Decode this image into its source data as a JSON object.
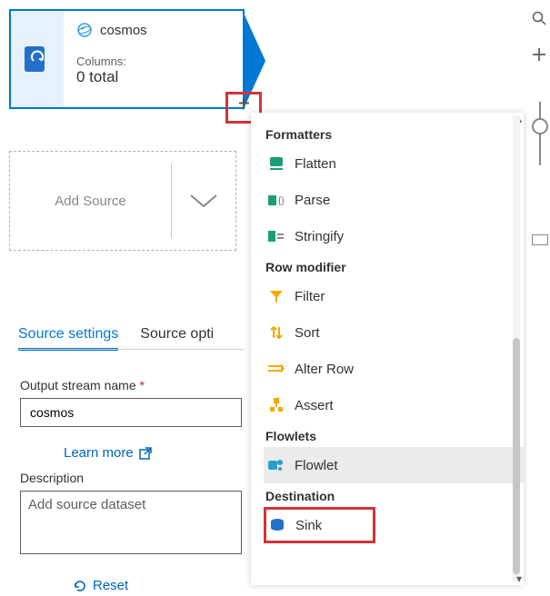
{
  "node": {
    "title": "cosmos",
    "columns_label": "Columns:",
    "columns_value": "0 total"
  },
  "add_source_label": "Add Source",
  "tabs": {
    "active": "Source settings",
    "second": "Source opti"
  },
  "form": {
    "output_stream_label": "Output stream name",
    "output_stream_value": "cosmos",
    "learn_more": "Learn more",
    "description_label": "Description",
    "description_placeholder": "Add source dataset",
    "reset": "Reset"
  },
  "panel": {
    "groups": {
      "formatters": {
        "title": "Formatters",
        "items": [
          "Flatten",
          "Parse",
          "Stringify"
        ]
      },
      "row_modifier": {
        "title": "Row modifier",
        "items": [
          "Filter",
          "Sort",
          "Alter Row",
          "Assert"
        ]
      },
      "flowlets": {
        "title": "Flowlets",
        "items": [
          "Flowlet"
        ]
      },
      "destination": {
        "title": "Destination",
        "items": [
          "Sink"
        ]
      }
    }
  }
}
